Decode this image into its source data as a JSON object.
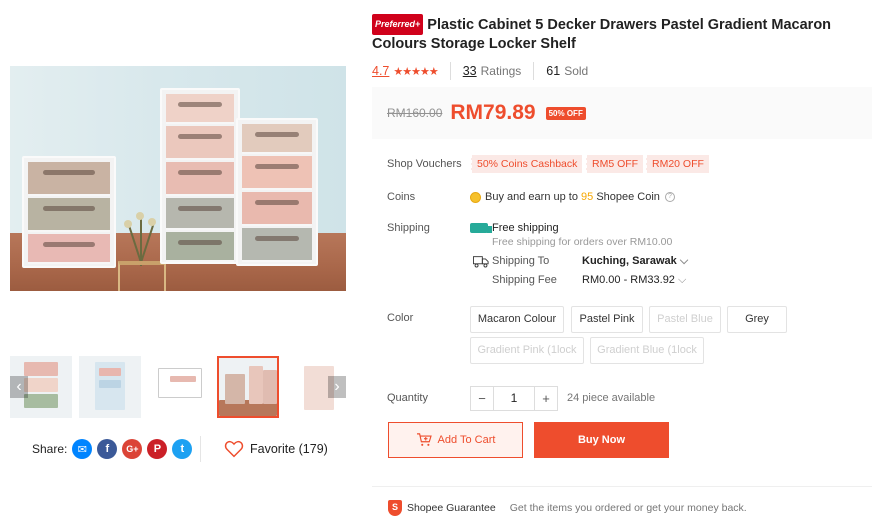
{
  "product": {
    "badge": "Preferred+",
    "title": "Plastic Cabinet 5 Decker Drawers Pastel Gradient Macaron Colours Storage Locker Shelf",
    "rating": "4.7",
    "stars": "★★★★★",
    "ratings_count": "33",
    "ratings_label": "Ratings",
    "sold_count": "61",
    "sold_label": "Sold"
  },
  "price": {
    "original": "RM160.00",
    "current": "RM79.89",
    "discount": "50% OFF"
  },
  "vouchers": {
    "label": "Shop Vouchers",
    "items": [
      "50% Coins Cashback",
      "RM5 OFF",
      "RM20 OFF"
    ]
  },
  "coins": {
    "label": "Coins",
    "text_before": "Buy and earn up to ",
    "amount": "95",
    "text_after": " Shopee Coin"
  },
  "shipping": {
    "label": "Shipping",
    "free_title": "Free shipping",
    "free_sub": "Free shipping for orders over RM10.00",
    "to_label": "Shipping To",
    "to_value": "Kuching, Sarawak",
    "fee_label": "Shipping Fee",
    "fee_value": "RM0.00 - RM33.92"
  },
  "color": {
    "label": "Color",
    "options": [
      {
        "name": "Macaron Colour",
        "disabled": false
      },
      {
        "name": "Pastel Pink",
        "disabled": false
      },
      {
        "name": "Pastel Blue",
        "disabled": true
      },
      {
        "name": "Grey",
        "disabled": false
      },
      {
        "name": "Gradient Pink (1lock",
        "disabled": true
      },
      {
        "name": "Gradient Blue (1lock",
        "disabled": true
      }
    ]
  },
  "quantity": {
    "label": "Quantity",
    "minus": "−",
    "value": "1",
    "plus": "+",
    "stock": "24 piece available"
  },
  "actions": {
    "add_to_cart": "Add To Cart",
    "buy_now": "Buy Now"
  },
  "share": {
    "label": "Share:",
    "icons": [
      "messenger-icon",
      "facebook-icon",
      "google-plus-icon",
      "pinterest-icon",
      "twitter-icon"
    ]
  },
  "favorite": {
    "label": "Favorite (179)"
  },
  "guarantee": {
    "title": "Shopee Guarantee",
    "text": "Get the items you ordered or get your money back."
  },
  "colors": {
    "accent": "#ee4d2d",
    "teal": "#26aa99"
  }
}
